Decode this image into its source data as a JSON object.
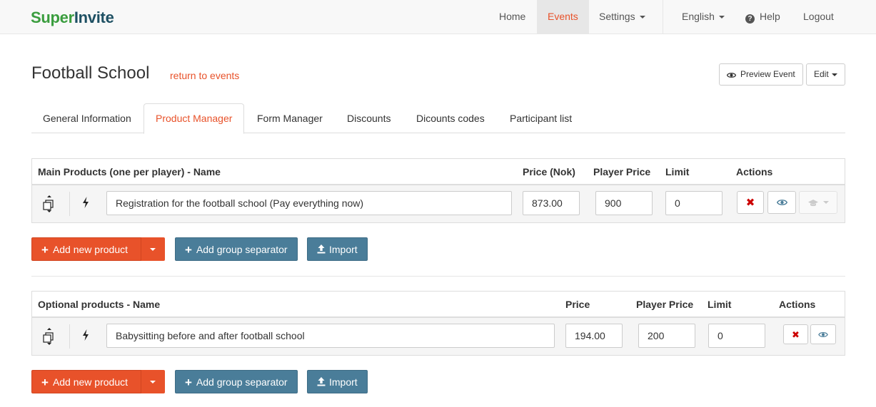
{
  "brand": {
    "part1": "Super",
    "part2": "Invite"
  },
  "nav": {
    "home": "Home",
    "events": "Events",
    "settings": "Settings",
    "language": "English",
    "help": "Help",
    "logout": "Logout"
  },
  "header": {
    "title": "Football School",
    "return_link": "return to events",
    "preview_label": "Preview Event",
    "edit_label": "Edit"
  },
  "tabs": [
    {
      "label": "General Information",
      "active": false
    },
    {
      "label": "Product Manager",
      "active": true
    },
    {
      "label": "Form Manager",
      "active": false
    },
    {
      "label": "Discounts",
      "active": false
    },
    {
      "label": "Dicounts codes",
      "active": false
    },
    {
      "label": "Participant list",
      "active": false
    }
  ],
  "main_products": {
    "headers": {
      "name": "Main Products (one per player) - Name",
      "price": "Price (Nok)",
      "player_price": "Player Price",
      "limit": "Limit",
      "actions": "Actions"
    },
    "rows": [
      {
        "name": "Registration for the football school (Pay everything now)",
        "price": "873.00",
        "player_price": "900",
        "limit": "0"
      }
    ]
  },
  "optional_products": {
    "headers": {
      "name": "Optional products - Name",
      "price": "Price",
      "player_price": "Player Price",
      "limit": "Limit",
      "actions": "Actions"
    },
    "rows": [
      {
        "name": "Babysitting before and after football school",
        "price": "194.00",
        "player_price": "200",
        "limit": "0"
      }
    ]
  },
  "buttons": {
    "add_product": "Add new product",
    "add_separator": "Add group separator",
    "import": "Import"
  },
  "colors": {
    "accent": "#e8522a",
    "secondary": "#4a7d99",
    "brand_green": "#3a9d3e",
    "brand_dark": "#1e5063"
  }
}
